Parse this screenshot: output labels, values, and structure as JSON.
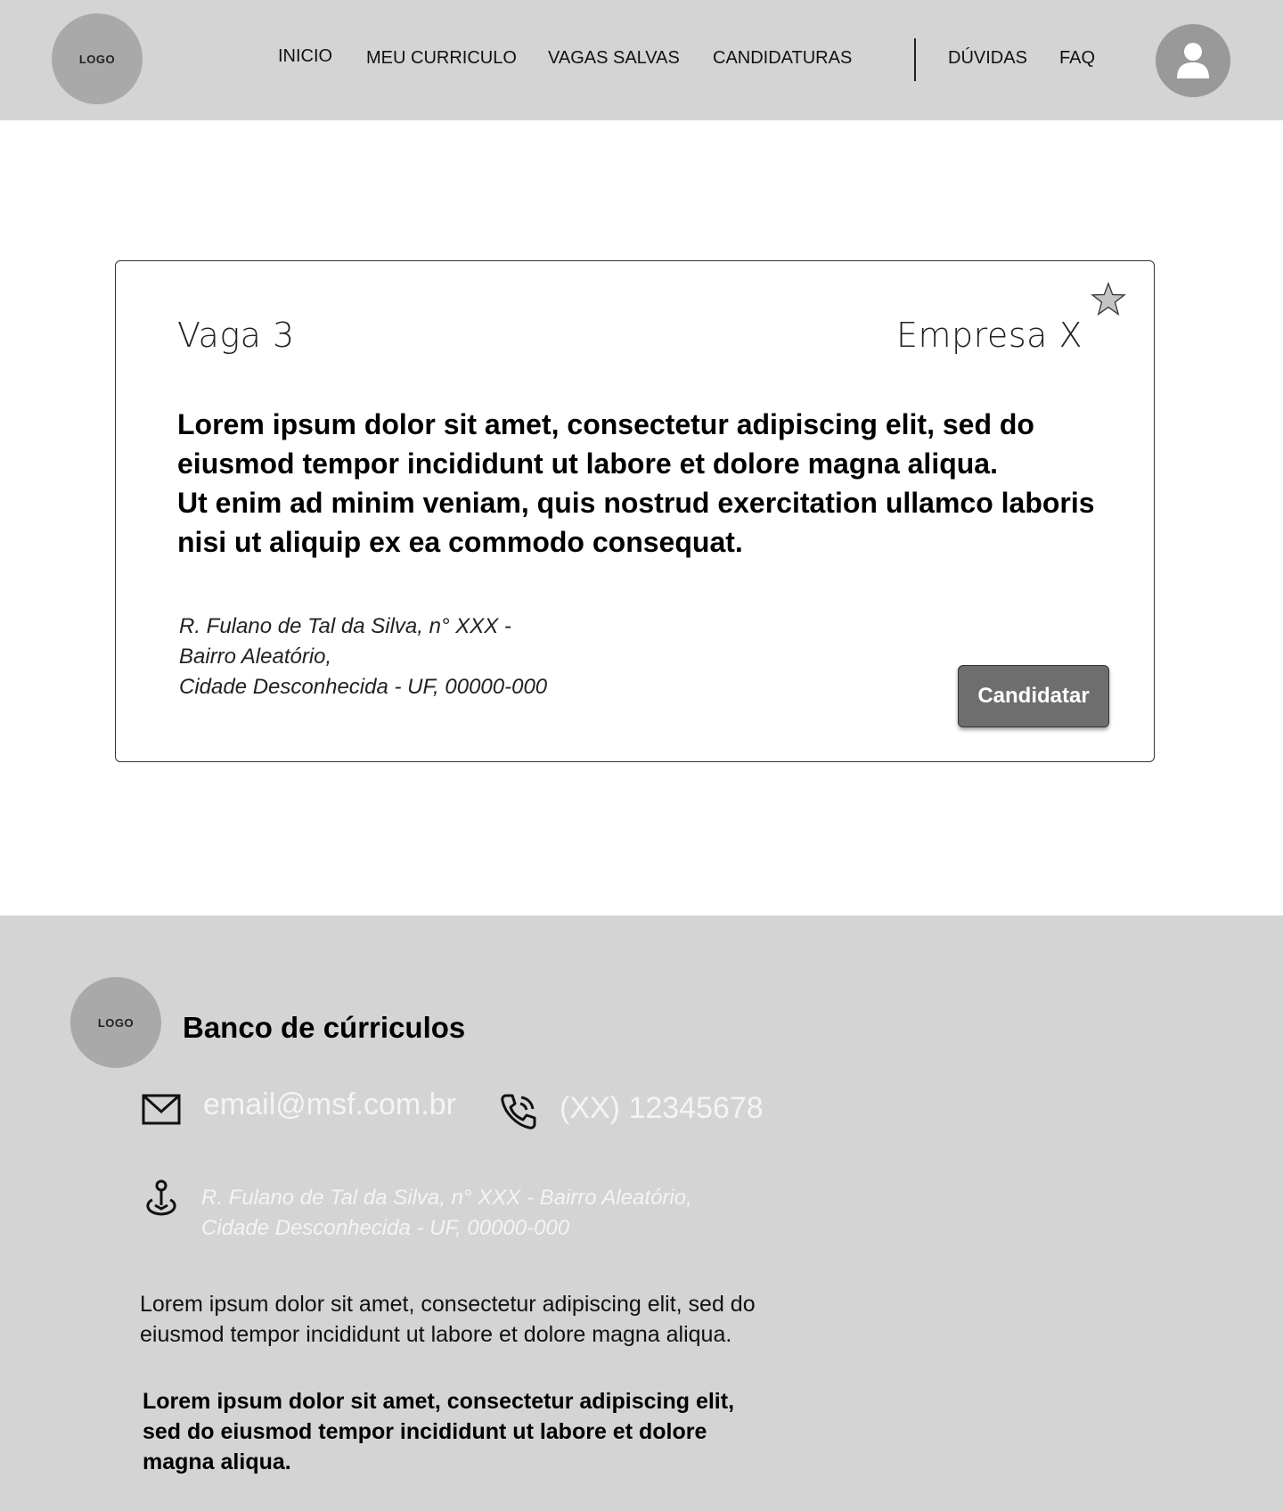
{
  "header": {
    "logo_text": "LOGO",
    "nav": [
      {
        "label": "INICIO"
      },
      {
        "label": "MEU CURRICULO"
      },
      {
        "label": "VAGAS SALVAS"
      },
      {
        "label": "CANDIDATURAS"
      },
      {
        "label": "DÚVIDAS"
      },
      {
        "label": "FAQ"
      }
    ],
    "avatar_icon": "user-icon"
  },
  "job": {
    "title": "Vaga 3",
    "company": "Empresa X",
    "favorite_icon": "star-icon",
    "description": [
      "Lorem ipsum dolor sit amet, consectetur adipiscing elit, sed do eiusmod tempor incididunt ut labore et dolore magna aliqua.",
      "Ut enim ad minim veniam, quis nostrud exercitation ullamco laboris nisi ut aliquip ex ea commodo consequat."
    ],
    "address": [
      "R. Fulano de Tal da Silva, n° XXX -",
      "Bairro Aleatório,",
      "Cidade Desconhecida - UF, 00000-000"
    ],
    "apply_label": "Candidatar"
  },
  "footer": {
    "logo_text": "LOGO",
    "brand": "Banco de cúrriculos",
    "email": "email@msf.com.br",
    "phone": "(XX) 12345678",
    "address": [
      "R. Fulano de Tal da Silva, n° XXX - Bairro Aleatório,",
      "Cidade Desconhecida - UF, 00000-000"
    ],
    "text": "Lorem ipsum dolor sit amet, consectetur adipiscing elit, sed do eiusmod tempor incididunt ut labore et dolore magna aliqua.",
    "text_bold": "Lorem ipsum dolor sit amet, consectetur adipiscing elit, sed do eiusmod tempor incididunt ut labore et dolore magna aliqua.",
    "icons": [
      "mail-icon",
      "phone-icon",
      "location-icon"
    ]
  },
  "colors": {
    "header_bg": "#d4d4d4",
    "logo_bg": "#a9a9a9",
    "button_bg": "#6e6e6e",
    "footer_text_light": "#f4f4f4"
  }
}
